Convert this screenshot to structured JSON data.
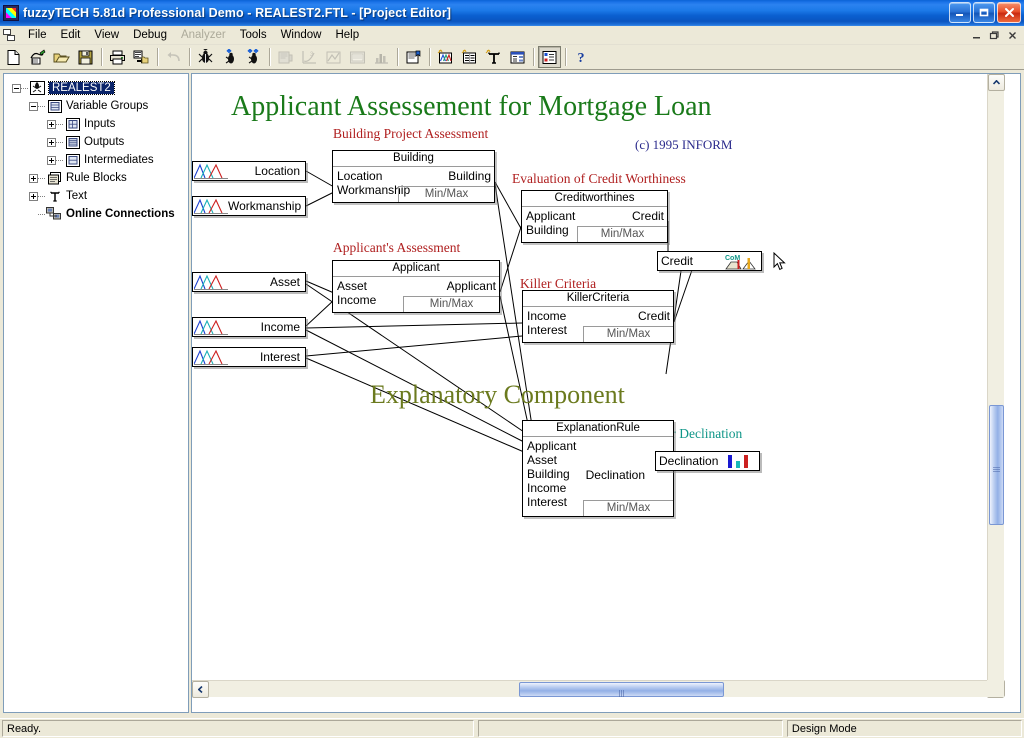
{
  "window": {
    "title": "fuzzyTECH 5.81d Professional Demo - REALEST2.FTL - [Project Editor]",
    "app_icon": "fuzzytech-logo-icon",
    "minimize": "minimize-button",
    "maximize": "maximize-button",
    "close": "close-button"
  },
  "menu": {
    "items": [
      {
        "label": "File",
        "disabled": false
      },
      {
        "label": "Edit",
        "disabled": false
      },
      {
        "label": "View",
        "disabled": false
      },
      {
        "label": "Debug",
        "disabled": false
      },
      {
        "label": "Analyzer",
        "disabled": true
      },
      {
        "label": "Tools",
        "disabled": false
      },
      {
        "label": "Window",
        "disabled": false
      },
      {
        "label": "Help",
        "disabled": false
      }
    ]
  },
  "toolbar": {
    "buttons": [
      {
        "name": "new-file-icon",
        "tip": "New",
        "disabled": false,
        "pressed": false
      },
      {
        "name": "new-project-wizard-icon",
        "tip": "Project Wizard",
        "disabled": false,
        "pressed": false
      },
      {
        "name": "open-folder-icon",
        "tip": "Open",
        "disabled": false,
        "pressed": false
      },
      {
        "name": "save-disk-icon",
        "tip": "Save",
        "disabled": false,
        "pressed": false
      },
      {
        "name": "separator",
        "tip": "",
        "disabled": false,
        "pressed": false
      },
      {
        "name": "print-icon",
        "tip": "Print",
        "disabled": false,
        "pressed": false
      },
      {
        "name": "export-icon",
        "tip": "Export",
        "disabled": false,
        "pressed": false
      },
      {
        "name": "separator",
        "tip": "",
        "disabled": false,
        "pressed": false
      },
      {
        "name": "undo-icon",
        "tip": "Undo",
        "disabled": true,
        "pressed": false
      },
      {
        "name": "separator",
        "tip": "",
        "disabled": false,
        "pressed": false
      },
      {
        "name": "debug-bug-icon",
        "tip": "Debug",
        "disabled": false,
        "pressed": false
      },
      {
        "name": "step-into-icon",
        "tip": "Step Into",
        "disabled": false,
        "pressed": false
      },
      {
        "name": "step-over-icon",
        "tip": "Step Over",
        "disabled": false,
        "pressed": false
      },
      {
        "name": "separator",
        "tip": "",
        "disabled": false,
        "pressed": false
      },
      {
        "name": "file-recorder-icon",
        "tip": "File Recorder",
        "disabled": true,
        "pressed": false
      },
      {
        "name": "transfer-plot-icon",
        "tip": "Transfer Plot",
        "disabled": true,
        "pressed": false
      },
      {
        "name": "time-plot-icon",
        "tip": "Time Plot",
        "disabled": true,
        "pressed": false
      },
      {
        "name": "watch-window-icon",
        "tip": "Watch Window",
        "disabled": true,
        "pressed": false
      },
      {
        "name": "statistics-icon",
        "tip": "Statistics",
        "disabled": true,
        "pressed": false
      },
      {
        "name": "separator",
        "tip": "",
        "disabled": false,
        "pressed": false
      },
      {
        "name": "project-properties-icon",
        "tip": "Project Editor",
        "disabled": false,
        "pressed": false
      },
      {
        "name": "separator",
        "tip": "",
        "disabled": false,
        "pressed": false
      },
      {
        "name": "variable-editor-icon",
        "tip": "Variable Editor",
        "disabled": false,
        "pressed": false
      },
      {
        "name": "rule-editor-icon",
        "tip": "Rule Editor",
        "disabled": false,
        "pressed": false
      },
      {
        "name": "text-editor-icon",
        "tip": "Text Editor",
        "disabled": false,
        "pressed": false
      },
      {
        "name": "spreadsheet-icon",
        "tip": "Spreadsheet Rule Editor",
        "disabled": false,
        "pressed": false
      },
      {
        "name": "separator",
        "tip": "",
        "disabled": false,
        "pressed": false
      },
      {
        "name": "project-tree-icon",
        "tip": "Project Tree",
        "disabled": false,
        "pressed": true
      },
      {
        "name": "separator",
        "tip": "",
        "disabled": false,
        "pressed": false
      },
      {
        "name": "help-question-icon",
        "tip": "Help",
        "disabled": false,
        "pressed": false
      }
    ]
  },
  "tree": {
    "nodes": [
      {
        "label": "REALEST2",
        "indent": 0,
        "toggle": "minus",
        "icon": "project-icon",
        "selected": true,
        "bold": false
      },
      {
        "label": "Variable Groups",
        "indent": 1,
        "toggle": "minus",
        "icon": "group-icon",
        "selected": false,
        "bold": false
      },
      {
        "label": "Inputs",
        "indent": 2,
        "toggle": "plus",
        "icon": "inputs-icon",
        "selected": false,
        "bold": false
      },
      {
        "label": "Outputs",
        "indent": 2,
        "toggle": "plus",
        "icon": "outputs-icon",
        "selected": false,
        "bold": false
      },
      {
        "label": "Intermediates",
        "indent": 2,
        "toggle": "plus",
        "icon": "intermediates-icon",
        "selected": false,
        "bold": false
      },
      {
        "label": "Rule Blocks",
        "indent": 1,
        "toggle": "plus",
        "icon": "ruleblocks-icon",
        "selected": false,
        "bold": false
      },
      {
        "label": "Text",
        "indent": 1,
        "toggle": "plus",
        "icon": "text-icon",
        "selected": false,
        "bold": false
      },
      {
        "label": "Online Connections",
        "indent": 1,
        "toggle": "none",
        "icon": "network-icon",
        "selected": false,
        "bold": true
      }
    ]
  },
  "diagram": {
    "headings": {
      "main_title": "Applicant Assessement for Mortgage Loan",
      "copyright": "(c) 1995 INFORM",
      "building_project": "Building Project Assessment",
      "applicants_assessment": "Applicant's Assessment",
      "credit_worthiness": "Evaluation of Credit Worthiness",
      "killer_criteria": "Killer Criteria",
      "explanatory_component": "Explanatory Component",
      "reason_for_declination": "son for Declination"
    },
    "input_variables": [
      {
        "name": "Location",
        "icon": "membership-function-icon"
      },
      {
        "name": "Workmanship",
        "icon": "membership-function-icon"
      },
      {
        "name": "Asset",
        "icon": "membership-function-icon"
      },
      {
        "name": "Income",
        "icon": "membership-function-icon"
      },
      {
        "name": "Interest",
        "icon": "membership-function-icon"
      }
    ],
    "output_variables": [
      {
        "name": "Credit",
        "icon": "com-defuzzification-icon"
      },
      {
        "name": "Declination",
        "icon": "bar-defuzzification-icon"
      }
    ],
    "rule_blocks": [
      {
        "title": "Building",
        "inputs": [
          "Location",
          "Workmanship"
        ],
        "output": "Building",
        "operator": "Min/Max"
      },
      {
        "title": "Applicant",
        "inputs": [
          "Asset",
          "Income"
        ],
        "output": "Applicant",
        "operator": "Min/Max"
      },
      {
        "title": "Creditworthines",
        "inputs": [
          "Applicant",
          "Building"
        ],
        "output": "Credit",
        "operator": "Min/Max"
      },
      {
        "title": "KillerCriteria",
        "inputs": [
          "Income",
          "Interest"
        ],
        "output": "Credit",
        "operator": "Min/Max"
      },
      {
        "title": "ExplanationRule",
        "inputs": [
          "Applicant",
          "Asset",
          "Building",
          "Income",
          "Interest"
        ],
        "output": "Declination",
        "operator": "Min/Max"
      }
    ],
    "defuzz_label": "CoM",
    "colors": {
      "main_title": "#1a7a1a",
      "section_red": "#b02020",
      "section_olive": "#6b7a1e",
      "section_teal": "#0f9688",
      "copyright_blue": "#2a2a8c"
    }
  },
  "scrollbars": {
    "vertical": {
      "name": "canvas-vertical-scrollbar",
      "up": "scroll-up-arrow",
      "down": "scroll-down-arrow"
    },
    "horizontal": {
      "name": "canvas-horizontal-scrollbar",
      "left": "scroll-left-arrow",
      "right": "scroll-right-arrow"
    }
  },
  "statusbar": {
    "message": "Ready.",
    "mode": "Design Mode"
  }
}
